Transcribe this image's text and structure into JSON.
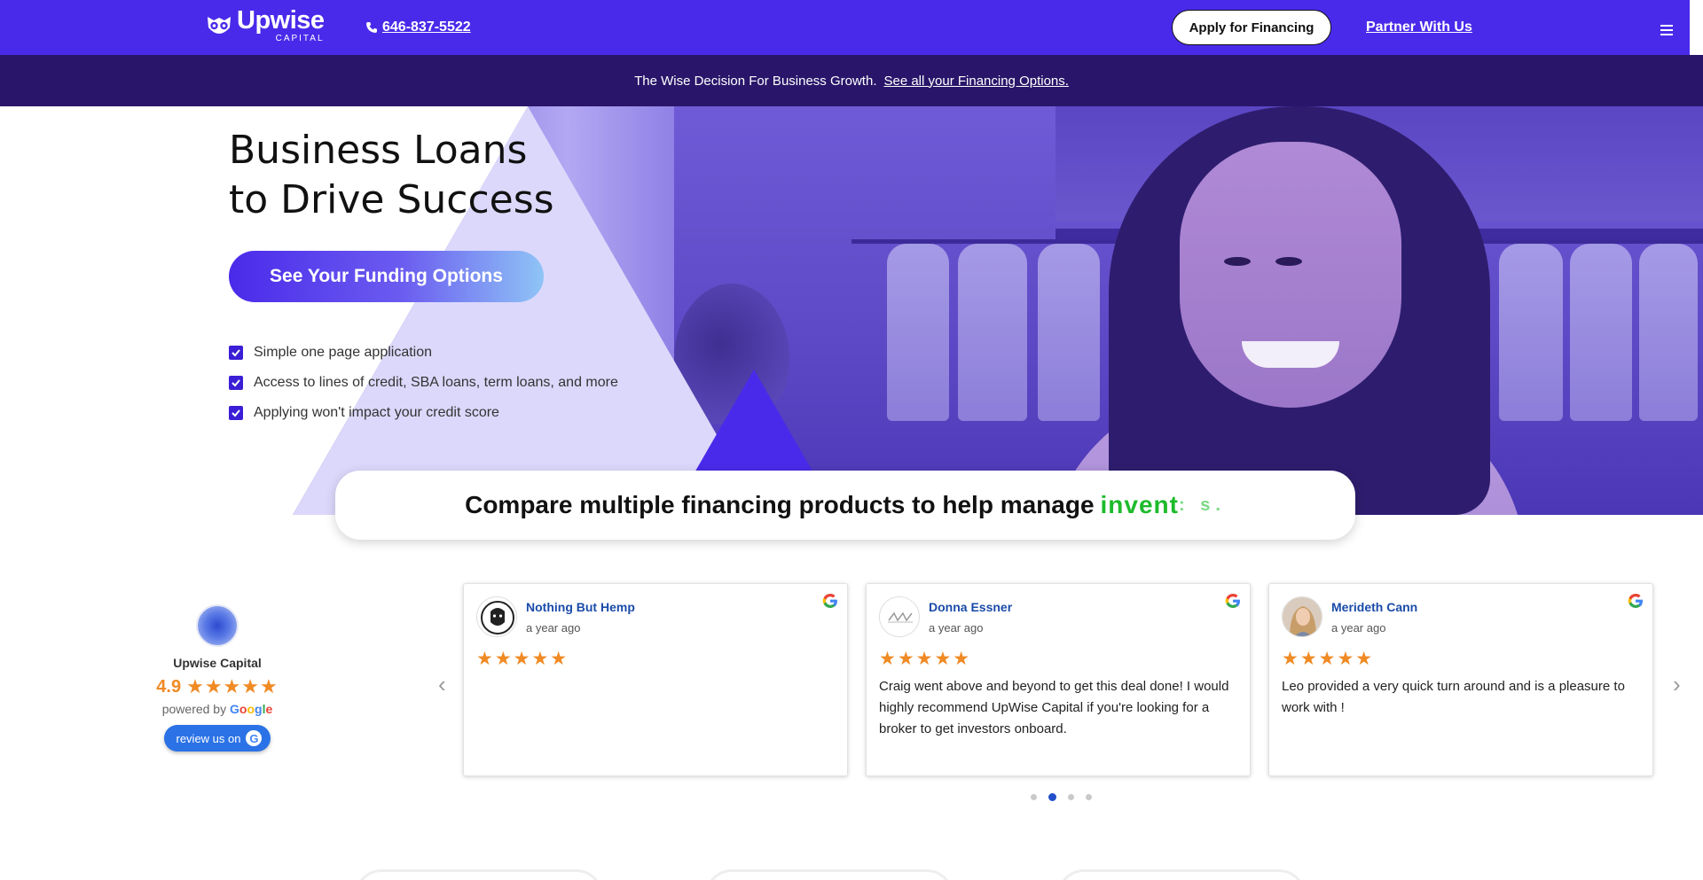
{
  "header": {
    "logo_name": "Upwise",
    "logo_sub": "CAPITAL",
    "phone": "646-837-5522",
    "apply_label": "Apply for Financing",
    "partner_label": "Partner With Us"
  },
  "announcement": {
    "text": "The Wise Decision For Business Growth.",
    "link": "See all your Financing Options."
  },
  "hero": {
    "title_line1": "Business Loans",
    "title_line2": "to Drive Success",
    "cta_label": "See Your Funding Options",
    "checks": [
      "Simple one page application",
      "Access to lines of credit, SBA loans, term loans, and more",
      "Applying won't impact your credit score"
    ]
  },
  "compare": {
    "text": "Compare multiple financing products to help manage",
    "rotating": "invent",
    "rotating_tail": ": s."
  },
  "reviews_badge": {
    "name": "Upwise Capital",
    "score": "4.9",
    "stars": "★★★★★",
    "powered_by": "powered by",
    "google": "Google",
    "review_us": "review us on"
  },
  "reviews": [
    {
      "name": "Nothing But Hemp",
      "date": "a year ago",
      "stars": "★★★★★",
      "text": ""
    },
    {
      "name": "Donna Essner",
      "date": "a year ago",
      "stars": "★★★★★",
      "text": "Craig went above and beyond to get this deal done!  I would highly recommend UpWise Capital if you're looking for a broker to get investors onboard."
    },
    {
      "name": "Merideth Cann",
      "date": "a year ago",
      "stars": "★★★★★",
      "text": "Leo provided a very quick turn around and is a pleasure to work with !"
    }
  ],
  "carousel": {
    "prev": "‹",
    "next": "›",
    "active_dot": 2,
    "dot_count": 4
  },
  "colors": {
    "brand": "#4a2aea",
    "dark_bar": "#29166a",
    "star": "#f08a24",
    "rotating_text": "#1dbb2b"
  },
  "icons": {
    "phone": "phone-icon",
    "menu": "hamburger-icon",
    "check": "checkbox-icon",
    "google": "google-icon"
  }
}
